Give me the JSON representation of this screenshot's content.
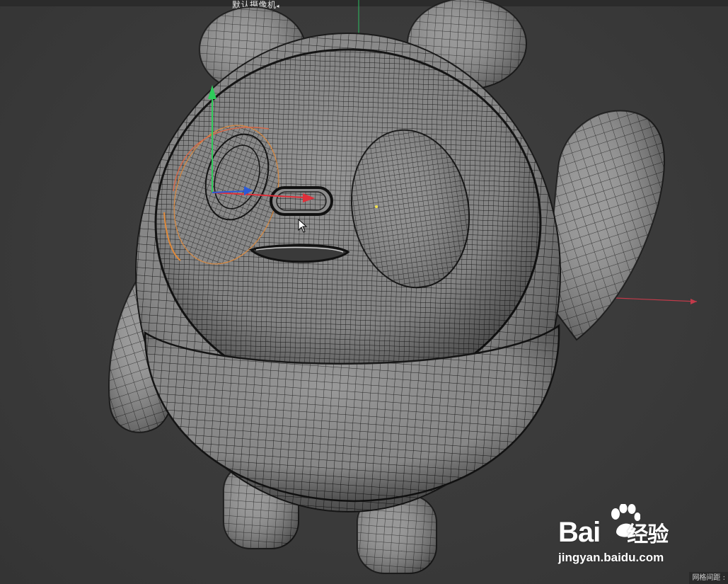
{
  "viewport": {
    "camera_label": "默认摄像机",
    "camera_suffix_icon": "camera-dot-icon",
    "grid_spacing_label": "网格间距 :"
  },
  "watermark": {
    "brand": "Bai",
    "brand_suffix": "经验",
    "url": "jingyan.baidu.com",
    "paw_icon": "baidu-paw-icon"
  },
  "gizmo": {
    "icon": "move-gizmo-icon",
    "colors": {
      "x": "#e0303a",
      "y": "#2ecc5a",
      "z": "#2b5bd8"
    }
  },
  "colors": {
    "background": "#3b3b3b",
    "mesh": "#8e8e8e",
    "wire": "#1a1a1a",
    "selection": "#e08a3a"
  }
}
